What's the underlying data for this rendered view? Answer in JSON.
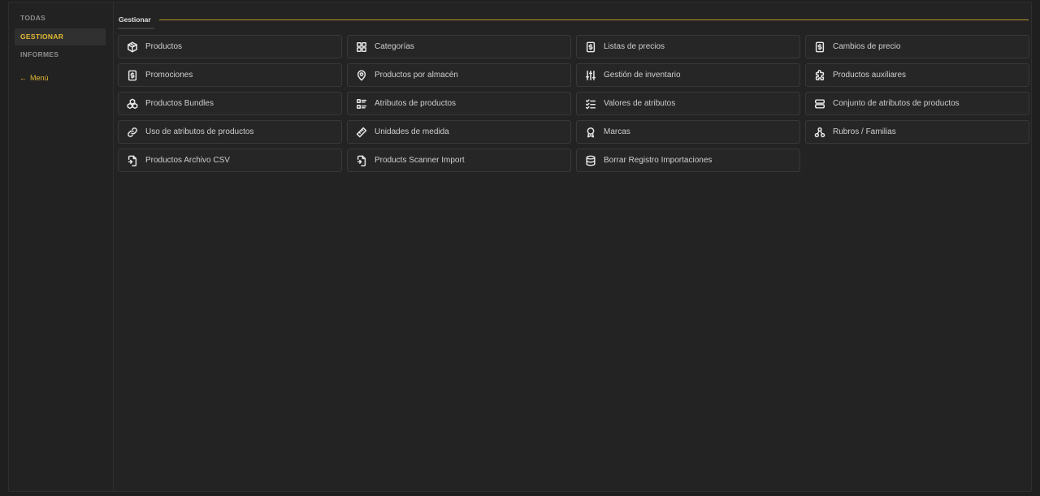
{
  "sidebar": {
    "items": [
      {
        "label": "TODAS",
        "active": false
      },
      {
        "label": "GESTIONAR",
        "active": true
      },
      {
        "label": "INFORMES",
        "active": false
      }
    ],
    "back_arrow": "←",
    "back_label": "Menú"
  },
  "section": {
    "title": "Gestionar"
  },
  "accent_color": "#e2b933",
  "cards": [
    {
      "label": "Productos",
      "icon": "box-icon"
    },
    {
      "label": "Categorías",
      "icon": "grid-icon"
    },
    {
      "label": "Listas de precios",
      "icon": "price-tag-icon"
    },
    {
      "label": "Cambios de precio",
      "icon": "price-change-icon"
    },
    {
      "label": "Promociones",
      "icon": "promotion-icon"
    },
    {
      "label": "Productos por almacén",
      "icon": "location-pin-icon"
    },
    {
      "label": "Gestión de inventario",
      "icon": "sliders-icon"
    },
    {
      "label": "Productos auxiliares",
      "icon": "puzzle-icon"
    },
    {
      "label": "Productos Bundles",
      "icon": "bundle-icon"
    },
    {
      "label": "Atributos de productos",
      "icon": "attribute-list-icon"
    },
    {
      "label": "Valores de atributos",
      "icon": "checklist-icon"
    },
    {
      "label": "Conjunto de atributos de productos",
      "icon": "server-stack-icon"
    },
    {
      "label": "Uso de atributos de productos",
      "icon": "link-icon"
    },
    {
      "label": "Unidades de medida",
      "icon": "ruler-icon"
    },
    {
      "label": "Marcas",
      "icon": "badge-icon"
    },
    {
      "label": "Rubros / Familias",
      "icon": "family-tree-icon"
    },
    {
      "label": "Productos Archivo CSV",
      "icon": "file-import-icon"
    },
    {
      "label": "Products Scanner Import",
      "icon": "file-scan-icon"
    },
    {
      "label": "Borrar Registro Importaciones",
      "icon": "database-icon"
    }
  ]
}
